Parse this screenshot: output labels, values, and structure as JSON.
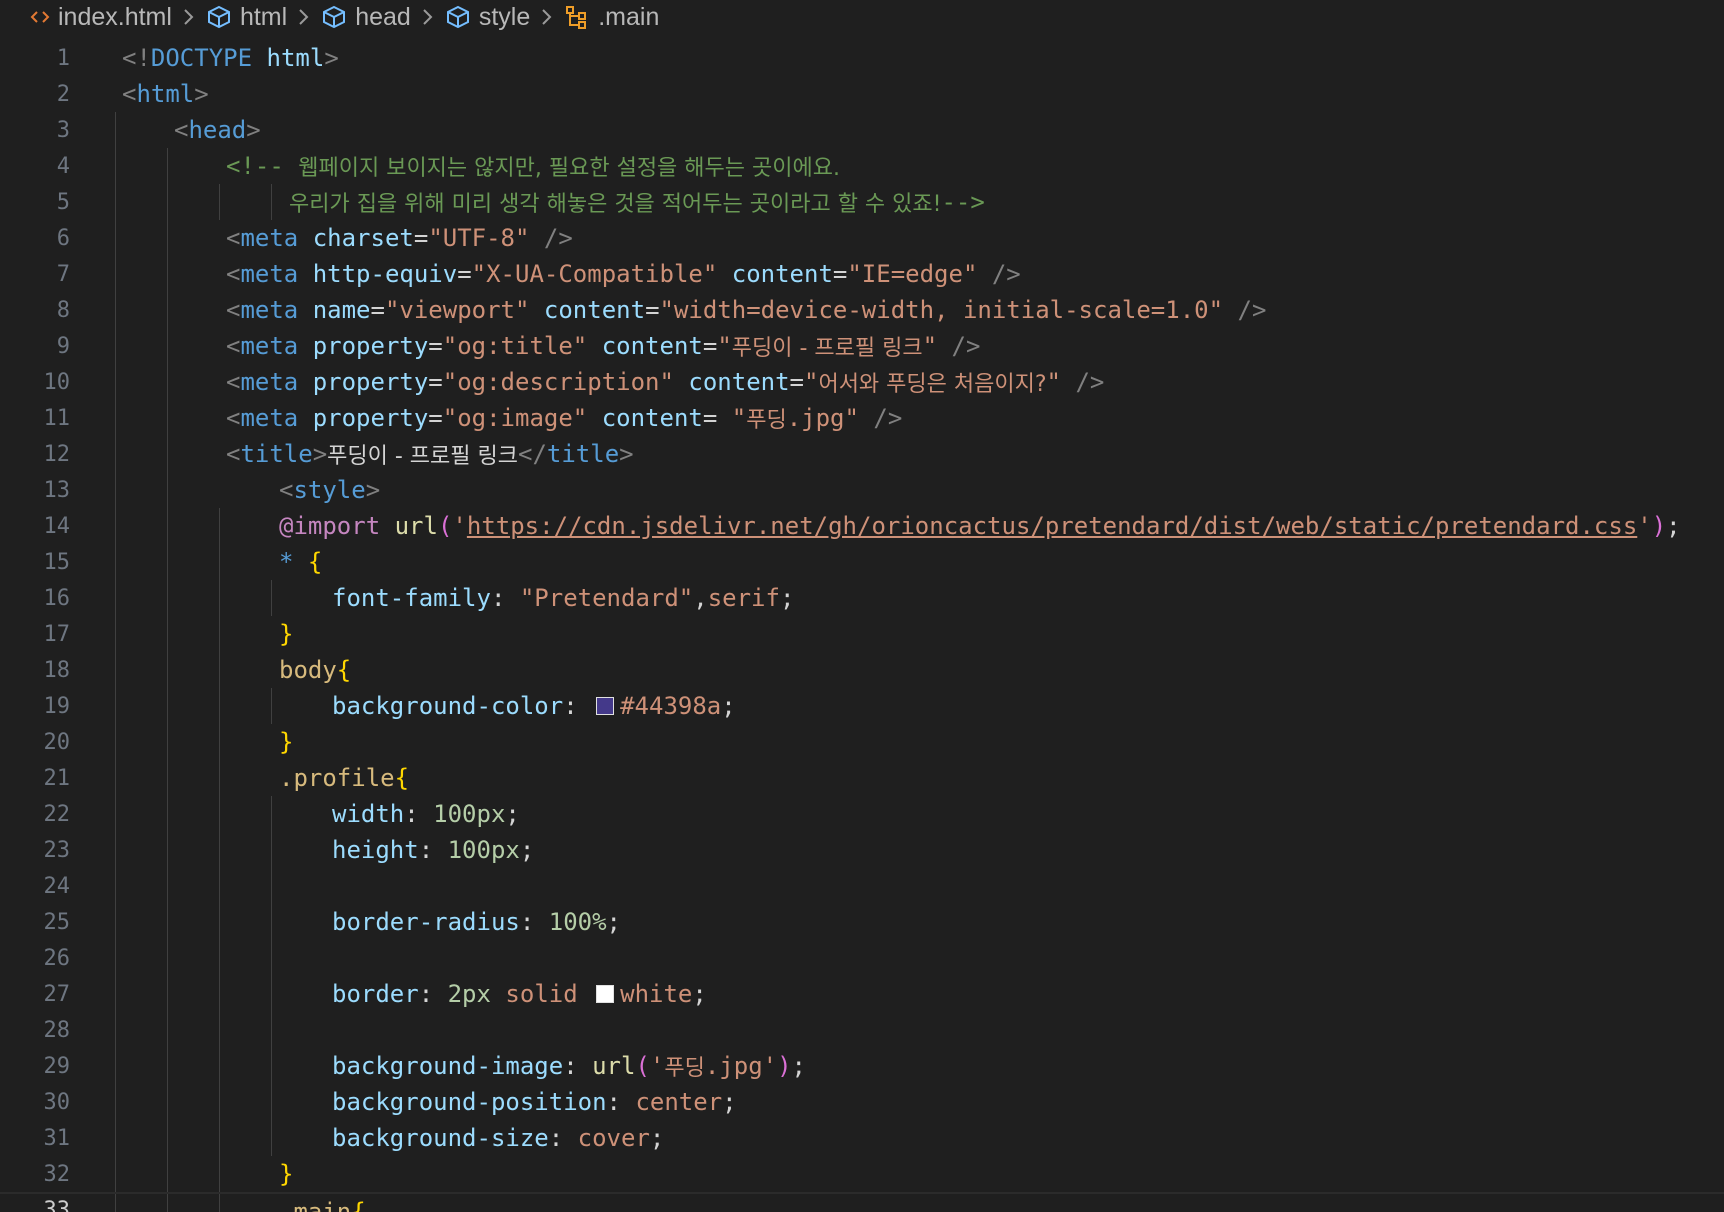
{
  "breadcrumb": {
    "items": [
      {
        "label": "index.html",
        "icon": "html-file-icon"
      },
      {
        "label": "html",
        "icon": "element-box-icon"
      },
      {
        "label": "head",
        "icon": "element-box-icon"
      },
      {
        "label": "style",
        "icon": "element-box-icon"
      },
      {
        "label": ".main",
        "icon": "css-selector-icon"
      }
    ],
    "separator_icon": "chevron-right-icon"
  },
  "colors": {
    "background": "#1f1f1f",
    "swatch_body_bg": "#44398a",
    "swatch_white": "#ffffff"
  },
  "lines": [
    {
      "n": "1",
      "tokens": [
        [
          "t-punc",
          "<!"
        ],
        [
          "t-tag",
          "DOCTYPE"
        ],
        [
          "t-plain",
          " "
        ],
        [
          "t-attr",
          "html"
        ],
        [
          "t-punc",
          ">"
        ]
      ]
    },
    {
      "n": "2",
      "tokens": [
        [
          "t-punc",
          "<"
        ],
        [
          "t-tag",
          "html"
        ],
        [
          "t-punc",
          ">"
        ]
      ]
    },
    {
      "n": "3",
      "tokens": [
        [
          "t-punc",
          "<"
        ],
        [
          "t-tag",
          "head"
        ],
        [
          "t-punc",
          ">"
        ]
      ]
    },
    {
      "n": "4",
      "tokens": [
        [
          "t-cmt",
          "<!-- "
        ],
        [
          "t-cmt kr",
          "웹페이지 보이지는 않지만, 필요한 설정을 해두는 곳이에요."
        ]
      ]
    },
    {
      "n": "5",
      "tokens": [
        [
          "t-cmt kr",
          "우리가 집을 위해 미리 생각 해놓은 것을 적어두는 곳이라고 할 수 있죠!"
        ],
        [
          "t-cmt",
          "-->"
        ]
      ]
    },
    {
      "n": "6",
      "tokens": [
        [
          "t-punc",
          "<"
        ],
        [
          "t-tag",
          "meta"
        ],
        [
          "t-plain",
          " "
        ],
        [
          "t-attr",
          "charset"
        ],
        [
          "t-plain",
          "="
        ],
        [
          "t-str",
          "\"UTF-8\""
        ],
        [
          "t-plain",
          " "
        ],
        [
          "t-punc",
          "/>"
        ]
      ]
    },
    {
      "n": "7",
      "tokens": [
        [
          "t-punc",
          "<"
        ],
        [
          "t-tag",
          "meta"
        ],
        [
          "t-plain",
          " "
        ],
        [
          "t-attr",
          "http-equiv"
        ],
        [
          "t-plain",
          "="
        ],
        [
          "t-str",
          "\"X-UA-Compatible\""
        ],
        [
          "t-plain",
          " "
        ],
        [
          "t-attr",
          "content"
        ],
        [
          "t-plain",
          "="
        ],
        [
          "t-str",
          "\"IE=edge\""
        ],
        [
          "t-plain",
          " "
        ],
        [
          "t-punc",
          "/>"
        ]
      ]
    },
    {
      "n": "8",
      "tokens": [
        [
          "t-punc",
          "<"
        ],
        [
          "t-tag",
          "meta"
        ],
        [
          "t-plain",
          " "
        ],
        [
          "t-attr",
          "name"
        ],
        [
          "t-plain",
          "="
        ],
        [
          "t-str",
          "\"viewport\""
        ],
        [
          "t-plain",
          " "
        ],
        [
          "t-attr",
          "content"
        ],
        [
          "t-plain",
          "="
        ],
        [
          "t-str",
          "\"width=device-width, initial-scale=1.0\""
        ],
        [
          "t-plain",
          " "
        ],
        [
          "t-punc",
          "/>"
        ]
      ]
    },
    {
      "n": "9",
      "tokens": [
        [
          "t-punc",
          "<"
        ],
        [
          "t-tag",
          "meta"
        ],
        [
          "t-plain",
          " "
        ],
        [
          "t-attr",
          "property"
        ],
        [
          "t-plain",
          "="
        ],
        [
          "t-str",
          "\"og:title\""
        ],
        [
          "t-plain",
          " "
        ],
        [
          "t-attr",
          "content"
        ],
        [
          "t-plain",
          "="
        ],
        [
          "t-str",
          "\""
        ],
        [
          "t-str kr",
          "푸딩이 - 프로필 링크"
        ],
        [
          "t-str",
          "\""
        ],
        [
          "t-plain",
          " "
        ],
        [
          "t-punc",
          "/>"
        ]
      ]
    },
    {
      "n": "10",
      "tokens": [
        [
          "t-punc",
          "<"
        ],
        [
          "t-tag",
          "meta"
        ],
        [
          "t-plain",
          " "
        ],
        [
          "t-attr",
          "property"
        ],
        [
          "t-plain",
          "="
        ],
        [
          "t-str",
          "\"og:description\""
        ],
        [
          "t-plain",
          " "
        ],
        [
          "t-attr",
          "content"
        ],
        [
          "t-plain",
          "="
        ],
        [
          "t-str",
          "\""
        ],
        [
          "t-str kr",
          "어서와 푸딩은 처음이지?"
        ],
        [
          "t-str",
          "\""
        ],
        [
          "t-plain",
          " "
        ],
        [
          "t-punc",
          "/>"
        ]
      ]
    },
    {
      "n": "11",
      "tokens": [
        [
          "t-punc",
          "<"
        ],
        [
          "t-tag",
          "meta"
        ],
        [
          "t-plain",
          " "
        ],
        [
          "t-attr",
          "property"
        ],
        [
          "t-plain",
          "="
        ],
        [
          "t-str",
          "\"og:image\""
        ],
        [
          "t-plain",
          " "
        ],
        [
          "t-attr",
          "content"
        ],
        [
          "t-plain",
          "= "
        ],
        [
          "t-str",
          "\""
        ],
        [
          "t-str kr",
          "푸딩"
        ],
        [
          "t-str",
          ".jpg\""
        ],
        [
          "t-plain",
          " "
        ],
        [
          "t-punc",
          "/>"
        ]
      ]
    },
    {
      "n": "12",
      "tokens": [
        [
          "t-punc",
          "<"
        ],
        [
          "t-tag",
          "title"
        ],
        [
          "t-punc",
          ">"
        ],
        [
          "t-text kr",
          "푸딩이 - 프로필 링크"
        ],
        [
          "t-punc",
          "</"
        ],
        [
          "t-tag",
          "title"
        ],
        [
          "t-punc",
          ">"
        ]
      ]
    },
    {
      "n": "13",
      "tokens": [
        [
          "t-punc",
          "<"
        ],
        [
          "t-tag",
          "style"
        ],
        [
          "t-punc",
          ">"
        ]
      ]
    },
    {
      "n": "14",
      "tokens": [
        [
          "t-at",
          "@import"
        ],
        [
          "t-plain",
          " "
        ],
        [
          "t-fn",
          "url"
        ],
        [
          "t-brace2",
          "("
        ],
        [
          "t-str",
          "'"
        ],
        [
          "t-url",
          "https://cdn.jsdelivr.net/gh/orioncactus/pretendard/dist/web/static/pretendard.css"
        ],
        [
          "t-str",
          "'"
        ],
        [
          "t-brace2",
          ")"
        ],
        [
          "t-plain",
          ";"
        ]
      ]
    },
    {
      "n": "15",
      "tokens": [
        [
          "t-star",
          "*"
        ],
        [
          "t-plain",
          " "
        ],
        [
          "t-brace",
          "{"
        ]
      ]
    },
    {
      "n": "16",
      "tokens": [
        [
          "t-prop",
          "font-family"
        ],
        [
          "t-plain",
          ": "
        ],
        [
          "t-val",
          "\"Pretendard\""
        ],
        [
          "t-plain",
          ","
        ],
        [
          "t-val",
          "serif"
        ],
        [
          "t-plain",
          ";"
        ]
      ]
    },
    {
      "n": "17",
      "tokens": [
        [
          "t-brace",
          "}"
        ]
      ]
    },
    {
      "n": "18",
      "tokens": [
        [
          "t-sel",
          "body"
        ],
        [
          "t-brace",
          "{"
        ]
      ]
    },
    {
      "n": "19",
      "tokens": [
        [
          "t-prop",
          "background-color"
        ],
        [
          "t-plain",
          ": "
        ],
        [
          "swatch",
          "#44398a"
        ],
        [
          "t-val",
          "#44398a"
        ],
        [
          "t-plain",
          ";"
        ]
      ]
    },
    {
      "n": "20",
      "tokens": [
        [
          "t-brace",
          "}"
        ]
      ]
    },
    {
      "n": "21",
      "tokens": [
        [
          "t-sel",
          ".profile"
        ],
        [
          "t-brace",
          "{"
        ]
      ]
    },
    {
      "n": "22",
      "tokens": [
        [
          "t-prop",
          "width"
        ],
        [
          "t-plain",
          ": "
        ],
        [
          "t-num",
          "100px"
        ],
        [
          "t-plain",
          ";"
        ]
      ]
    },
    {
      "n": "23",
      "tokens": [
        [
          "t-prop",
          "height"
        ],
        [
          "t-plain",
          ": "
        ],
        [
          "t-num",
          "100px"
        ],
        [
          "t-plain",
          ";"
        ]
      ]
    },
    {
      "n": "24",
      "tokens": []
    },
    {
      "n": "25",
      "tokens": [
        [
          "t-prop",
          "border-radius"
        ],
        [
          "t-plain",
          ": "
        ],
        [
          "t-num",
          "100%"
        ],
        [
          "t-plain",
          ";"
        ]
      ]
    },
    {
      "n": "26",
      "tokens": []
    },
    {
      "n": "27",
      "tokens": [
        [
          "t-prop",
          "border"
        ],
        [
          "t-plain",
          ": "
        ],
        [
          "t-num",
          "2px"
        ],
        [
          "t-plain",
          " "
        ],
        [
          "t-val",
          "solid"
        ],
        [
          "t-plain",
          " "
        ],
        [
          "swatch",
          "#ffffff"
        ],
        [
          "t-val",
          "white"
        ],
        [
          "t-plain",
          ";"
        ]
      ]
    },
    {
      "n": "28",
      "tokens": []
    },
    {
      "n": "29",
      "tokens": [
        [
          "t-prop",
          "background-image"
        ],
        [
          "t-plain",
          ": "
        ],
        [
          "t-fn",
          "url"
        ],
        [
          "t-brace2",
          "("
        ],
        [
          "t-str",
          "'"
        ],
        [
          "t-str kr",
          "푸딩"
        ],
        [
          "t-str",
          ".jpg'"
        ],
        [
          "t-brace2",
          ")"
        ],
        [
          "t-plain",
          ";"
        ]
      ]
    },
    {
      "n": "30",
      "tokens": [
        [
          "t-prop",
          "background-position"
        ],
        [
          "t-plain",
          ": "
        ],
        [
          "t-val",
          "center"
        ],
        [
          "t-plain",
          ";"
        ]
      ]
    },
    {
      "n": "31",
      "tokens": [
        [
          "t-prop",
          "background-size"
        ],
        [
          "t-plain",
          ": "
        ],
        [
          "t-val",
          "cover"
        ],
        [
          "t-plain",
          ";"
        ]
      ]
    },
    {
      "n": "32",
      "tokens": [
        [
          "t-brace",
          "}"
        ]
      ]
    },
    {
      "n": "33",
      "tokens": [
        [
          "t-sel",
          ".main"
        ],
        [
          "t-brace",
          "{"
        ]
      ]
    }
  ]
}
